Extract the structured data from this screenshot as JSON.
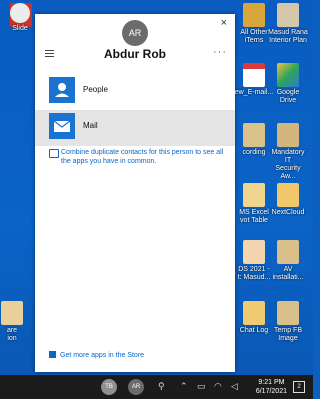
{
  "desktop_icons": [
    {
      "label": "",
      "color": "#c9342f"
    },
    {
      "label": "Slide",
      "color": "#d75b1f"
    },
    {
      "label": "",
      "color": "#e8e8e8"
    },
    {
      "label": "",
      "color": "#2f8f3a"
    },
    {
      "label": "",
      "color": "#e8e8e8"
    },
    {
      "label": "",
      "color": "#c9b54d"
    },
    {
      "label": "All Other\niTerns",
      "color": "#d9a63b"
    },
    {
      "label": "Masud Rana\nInterior Plan",
      "color": "#d4c7a9"
    },
    {
      "label": "ew_E-mail...",
      "color": "#d93b3b"
    },
    {
      "label": "Google Drive",
      "color": "#2f7bd1"
    },
    {
      "label": "cording",
      "color": "#d8c28a"
    },
    {
      "label": "Mandatory IT\nSecurity Aw...",
      "color": "#d3b67d"
    },
    {
      "label": "MS Excel\nvot Table",
      "color": "#f0d58f"
    },
    {
      "label": "NextCloud",
      "color": "#f0c86a"
    },
    {
      "label": "DS 2021 -\nt: Masud...",
      "color": "#f3d6b0"
    },
    {
      "label": "AV\ninstallati...",
      "color": "#d9c08a"
    },
    {
      "label": "are\nion",
      "color": "#e9d09a"
    },
    {
      "label": "Chat Log",
      "color": "#eecb72"
    },
    {
      "label": "Temp FB\nImage",
      "color": "#d9c08a"
    }
  ],
  "window": {
    "avatar_initials": "AR",
    "contact_name": "Abdur Rob",
    "close_glyph": "×",
    "more_glyph": "···",
    "apps": [
      {
        "label": "People",
        "selected": false
      },
      {
        "label": "Mail",
        "selected": true
      }
    ],
    "combine_text": "Combine duplicate contacts for this person to see all the apps you have in common.",
    "store_link": "Get more apps in the Store"
  },
  "taskbar": {
    "buttons": [
      {
        "label": "TB",
        "color": "#8f8f8f"
      },
      {
        "label": "AR",
        "color": "#6b6b6b"
      }
    ],
    "time": "9:21 PM",
    "date": "6/17/2021",
    "notification_count": "2"
  }
}
